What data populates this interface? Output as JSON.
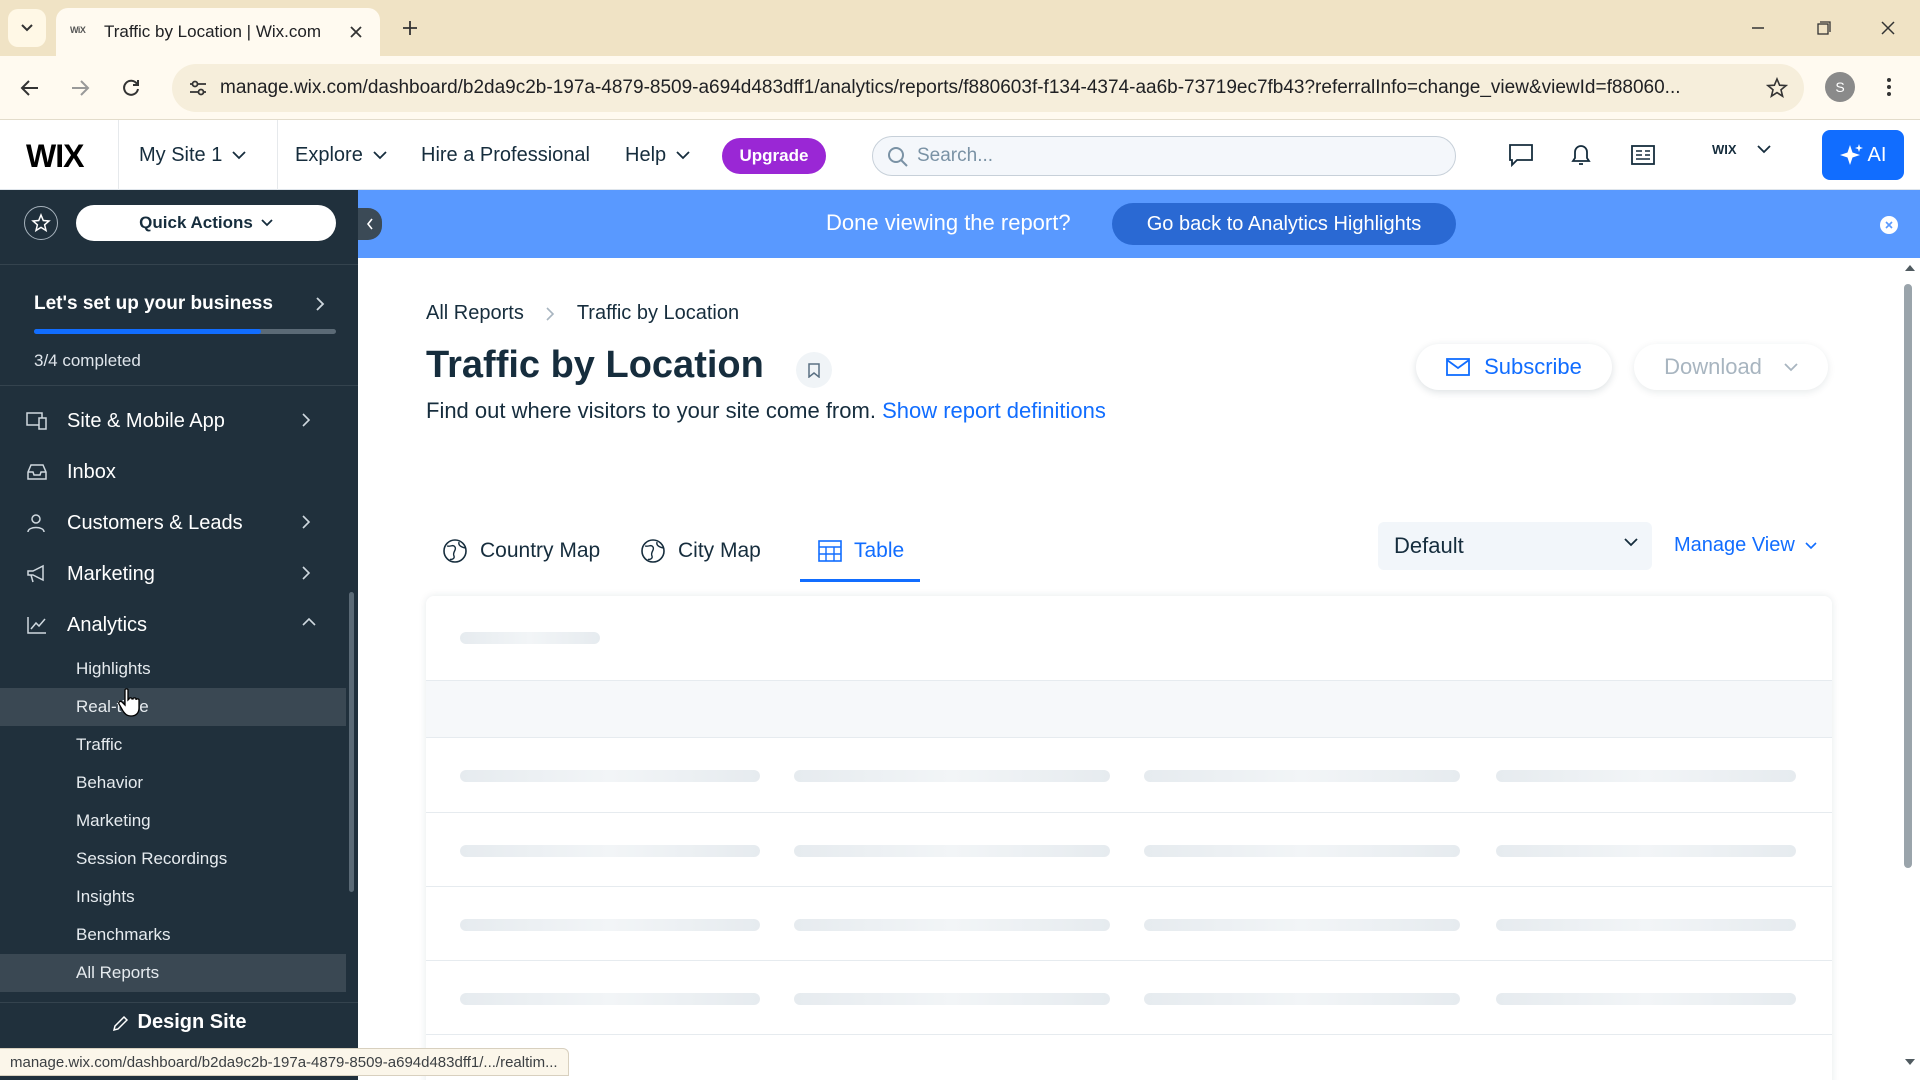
{
  "browser": {
    "tab_title": "Traffic by Location | Wix.com",
    "tab_favicon_text": "WiX",
    "url": "manage.wix.com/dashboard/b2da9c2b-197a-4879-8509-a694d483dff1/analytics/reports/f880603f-f134-4374-aa6b-73719ec7fb43?referralInfo=change_view&viewId=f88060...",
    "profile_initial": "S",
    "status_url": "manage.wix.com/dashboard/b2da9c2b-197a-4879-8509-a694d483dff1/.../realtim..."
  },
  "wix_topbar": {
    "logo": "WIX",
    "site_name": "My Site 1",
    "explore": "Explore",
    "hire": "Hire a Professional",
    "help": "Help",
    "upgrade": "Upgrade",
    "search_placeholder": "Search...",
    "account_label": "WIX",
    "ai_label": "AI"
  },
  "sidebar": {
    "quick_actions": "Quick Actions",
    "setup_title": "Let's set up your business",
    "setup_progress_fraction": 0.75,
    "setup_status": "3/4 completed",
    "items": [
      {
        "label": "Site & Mobile App"
      },
      {
        "label": "Inbox"
      },
      {
        "label": "Customers & Leads"
      },
      {
        "label": "Marketing"
      },
      {
        "label": "Analytics"
      }
    ],
    "analytics_sub": [
      "Highlights",
      "Real-time",
      "Traffic",
      "Behavior",
      "Marketing",
      "Session Recordings",
      "Insights",
      "Benchmarks",
      "All Reports"
    ],
    "design_site": "Design Site"
  },
  "banner": {
    "text": "Done viewing the report?",
    "button": "Go back to Analytics Highlights"
  },
  "main": {
    "breadcrumb_root": "All Reports",
    "breadcrumb_current": "Traffic by Location",
    "title": "Traffic by Location",
    "subtitle": "Find out where visitors to your site come from.",
    "definitions_link": "Show report definitions",
    "subscribe": "Subscribe",
    "download": "Download",
    "tabs": [
      "Country Map",
      "City Map",
      "Table"
    ],
    "active_tab": "Table",
    "view_select": "Default",
    "manage_view": "Manage View"
  },
  "colors": {
    "wix_blue": "#116dff",
    "upgrade_purple": "#9a27d5",
    "sidebar_bg": "#20303c",
    "banner_bg": "#5999ff"
  }
}
